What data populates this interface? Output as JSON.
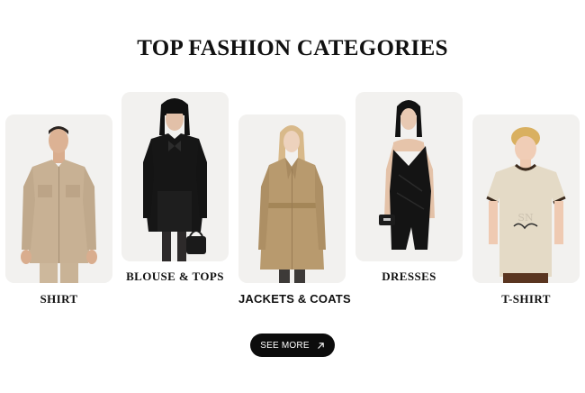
{
  "section": {
    "title": "TOP FASHION CATEGORIES"
  },
  "categories": [
    {
      "label": "SHIRT"
    },
    {
      "label": "BLOUSE & TOPS"
    },
    {
      "label": "JACKETS & COATS"
    },
    {
      "label": "DRESSES"
    },
    {
      "label": "T-SHIRT"
    }
  ],
  "cta": {
    "label": "SEE MORE",
    "icon": "arrow-up-right-icon"
  },
  "colors": {
    "card_bg": "#f2f1ef",
    "button_bg": "#0c0c0c",
    "text": "#111111"
  }
}
